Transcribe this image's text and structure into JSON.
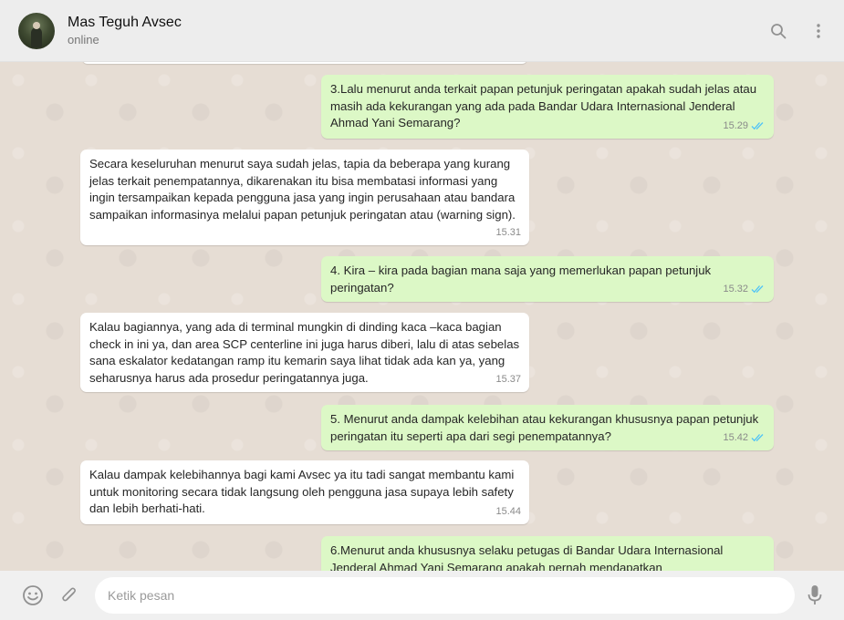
{
  "header": {
    "contact_name": "Mas Teguh Avsec",
    "status": "online",
    "icons": [
      "search-icon",
      "menu-icon"
    ]
  },
  "messages": [
    {
      "direction": "out",
      "text": "3.Lalu menurut anda terkait papan petunjuk peringatan apakah sudah jelas atau masih ada kekurangan yang ada pada Bandar Udara Internasional Jenderal Ahmad Yani Semarang?",
      "time": "15.29",
      "read": true
    },
    {
      "direction": "in",
      "text": "Secara keseluruhan menurut saya sudah jelas, tapia da beberapa yang kurang jelas terkait penempatannya, dikarenakan itu bisa membatasi informasi yang ingin tersampaikan kepada pengguna jasa yang ingin perusahaan atau bandara sampaikan informasinya melalui papan petunjuk peringatan atau (warning sign).",
      "time": "15.31"
    },
    {
      "direction": "out",
      "text": "4. Kira – kira pada bagian mana saja yang memerlukan papan petunjuk peringatan?",
      "time": "15.32",
      "read": true
    },
    {
      "direction": "in",
      "text": "Kalau bagiannya, yang ada di terminal mungkin di dinding  kaca –kaca bagian check in ini ya, dan area SCP centerline ini juga harus diberi, lalu di atas sebelas sana eskalator kedatangan ramp itu kemarin saya lihat tidak ada kan ya, yang seharusnya harus ada prosedur peringatannya juga.",
      "time": "15.37"
    },
    {
      "direction": "out",
      "text": "5. Menurut anda dampak kelebihan atau kekurangan khususnya papan petunjuk peringatan itu seperti apa dari segi penempatannya?",
      "time": "15.42",
      "read": true
    },
    {
      "direction": "in",
      "text": "Kalau dampak kelebihannya bagi kami Avsec ya itu tadi sangat membantu kami untuk monitoring secara tidak langsung oleh pengguna jasa supaya lebih safety dan lebih berhati-hati.",
      "time": "15.44"
    },
    {
      "direction": "out",
      "text": "6.Menurut anda khususnya selaku petugas di Bandar Udara Internasional Jenderal Ahmad Yani Semarang apakah pernah mendapatkan",
      "time": "",
      "read": false
    }
  ],
  "composer": {
    "placeholder": "Ketik pesan",
    "icons": [
      "emoji-icon",
      "attach-icon",
      "mic-icon"
    ]
  },
  "colors": {
    "outgoing_bubble": "#dcf8c6",
    "incoming_bubble": "#ffffff",
    "chat_background": "#e6ddd4",
    "read_ticks": "#4fc3f7"
  }
}
